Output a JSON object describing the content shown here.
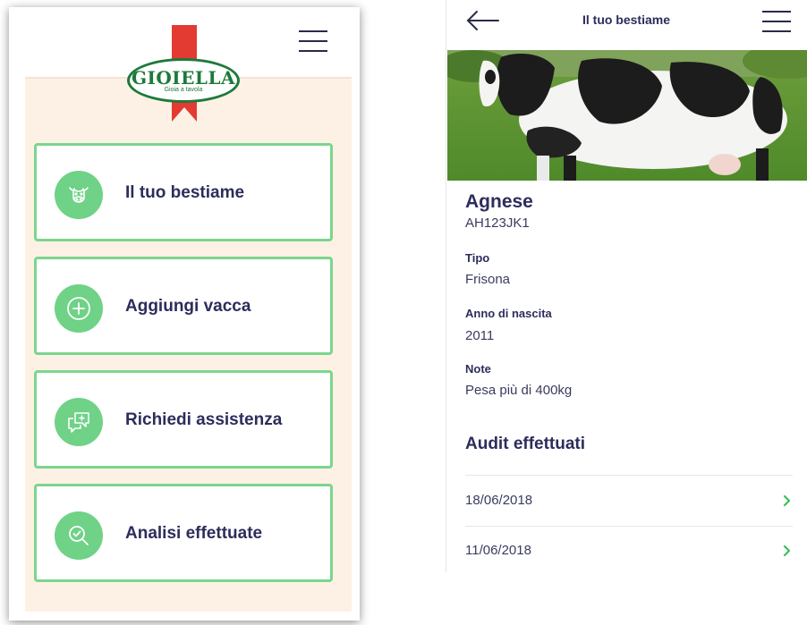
{
  "left": {
    "logo": {
      "brand": "GIOIELLA",
      "tagline": "Gioia a tavola"
    },
    "menu_cards": [
      {
        "label": "Il tuo bestiame",
        "icon": "cow-icon"
      },
      {
        "label": "Aggiungi vacca",
        "icon": "plus-circle-icon"
      },
      {
        "label": "Richiedi assistenza",
        "icon": "chat-bubbles-icon"
      },
      {
        "label": "Analisi effettuate",
        "icon": "magnifier-check-icon"
      }
    ]
  },
  "right": {
    "header": {
      "title": "Il tuo bestiame"
    },
    "cow": {
      "name": "Agnese",
      "code": "AH123JK1"
    },
    "fields": [
      {
        "label": "Tipo",
        "value": "Frisona"
      },
      {
        "label": "Anno di nascita",
        "value": "2011"
      },
      {
        "label": "Note",
        "value": "Pesa più di 400kg"
      }
    ],
    "audits": {
      "title": "Audit effettuati",
      "items": [
        {
          "date": "18/06/2018"
        },
        {
          "date": "11/06/2018"
        }
      ]
    }
  },
  "colors": {
    "accent_green": "#6fd286",
    "card_border": "#7bd68c",
    "navy": "#2c2d5b",
    "ribbon_red": "#e33a32"
  }
}
